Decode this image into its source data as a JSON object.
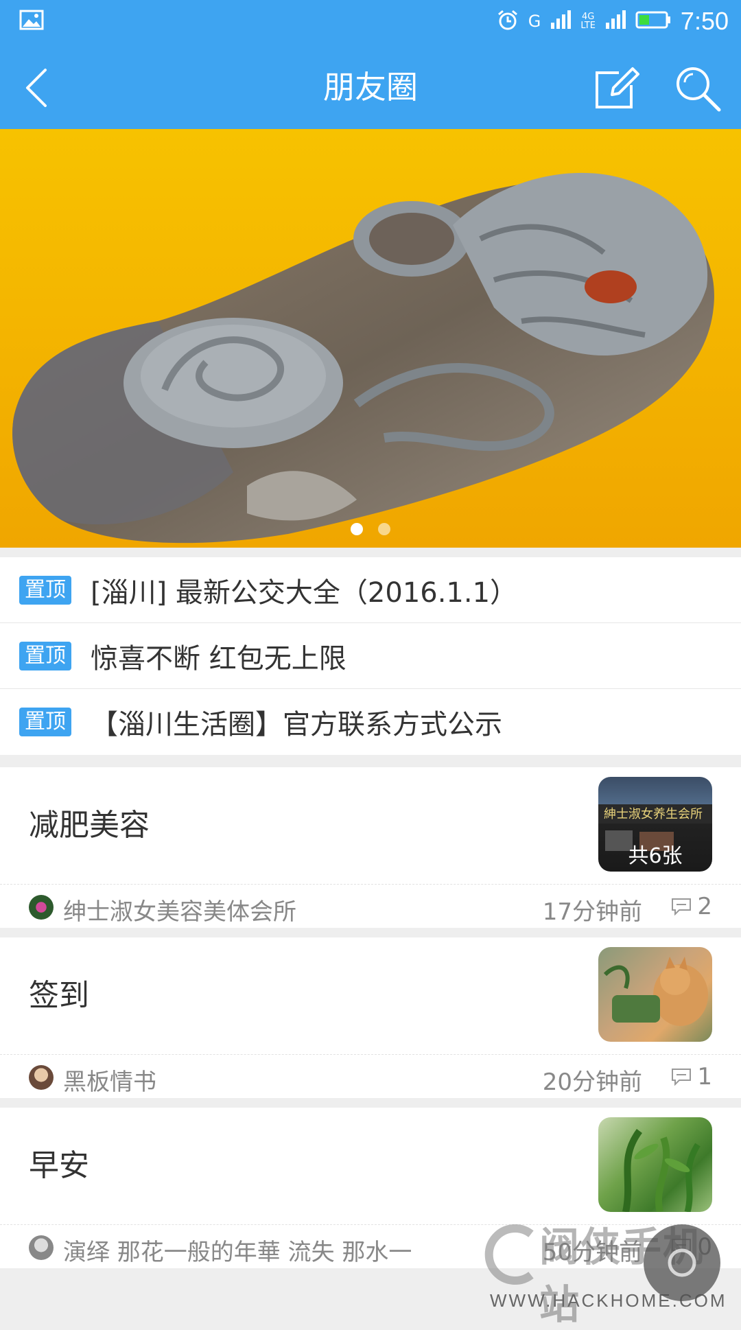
{
  "status_bar": {
    "time": "7:50",
    "network_g": "G",
    "network_4g": "4G",
    "network_lte": "LTE",
    "icons": [
      "image-notification-icon",
      "alarm-icon",
      "signal-icon",
      "battery-icon"
    ]
  },
  "header": {
    "title": "朋友圈",
    "back_icon": "back-icon",
    "edit_icon": "edit-icon",
    "search_icon": "search-icon"
  },
  "banner": {
    "page_count": 2,
    "active_page": 1,
    "background_color": "#f6b800"
  },
  "pinned": [
    {
      "tag": "置顶",
      "text": "[淄川] 最新公交大全（2016.1.1）"
    },
    {
      "tag": "置顶",
      "text": "惊喜不断  红包无上限"
    },
    {
      "tag": "置顶",
      "text": "【淄川生活圈】官方联系方式公示"
    }
  ],
  "posts": [
    {
      "title": "减肥美容",
      "thumb_count": "共6张",
      "author": "绅士淑女美容美体会所",
      "time": "17分钟前",
      "comments": "2"
    },
    {
      "title": "签到",
      "thumb_count": "",
      "author": "黑板情书",
      "time": "20分钟前",
      "comments": "1"
    },
    {
      "title": "早安",
      "thumb_count": "",
      "author": "演绎 那花一般的年華 流失 那水一",
      "time": "50分钟前",
      "comments": "0"
    }
  ],
  "watermark": {
    "name": "阀侠手机站",
    "url": "WWW.HACKHOME.COM"
  },
  "colors": {
    "accent": "#3ea4f1",
    "banner": "#f6b800"
  }
}
